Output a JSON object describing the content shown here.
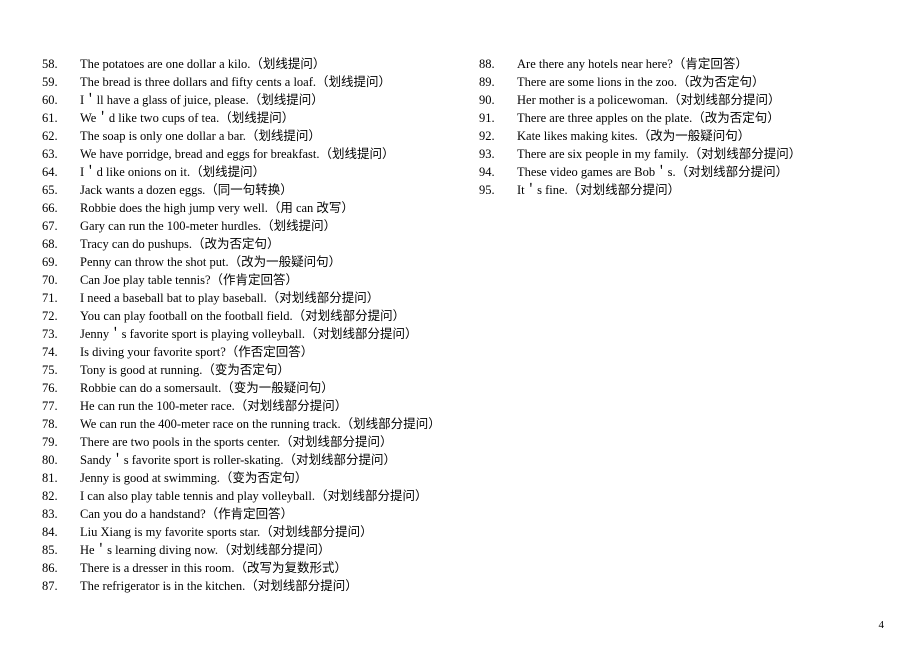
{
  "page_number": "4",
  "left_items": [
    {
      "n": "58.",
      "t": "The potatoes are one dollar a kilo.（划线提问）"
    },
    {
      "n": "59.",
      "t": "The bread is three dollars and fifty cents a loaf.（划线提问）"
    },
    {
      "n": "60.",
      "t": "I＇ll have a glass of juice, please.（划线提问）"
    },
    {
      "n": "61.",
      "t": "We＇d like two cups of tea.（划线提问）"
    },
    {
      "n": "62.",
      "t": "The soap is only one dollar a bar.（划线提问）"
    },
    {
      "n": "63.",
      "t": "We have porridge, bread and eggs for breakfast.（划线提问）"
    },
    {
      "n": "64.",
      "t": "I＇d like onions on it.（划线提问）"
    },
    {
      "n": "65.",
      "t": "Jack wants a dozen eggs.（同一句转换）"
    },
    {
      "n": "66.",
      "t": "Robbie does the high jump very well.（用 can  改写）"
    },
    {
      "n": "67.",
      "t": "Gary can run the 100-meter hurdles.（划线提问）"
    },
    {
      "n": "68.",
      "t": "Tracy can do pushups.（改为否定句）"
    },
    {
      "n": "69.",
      "t": "Penny can throw the shot put.（改为一般疑问句）"
    },
    {
      "n": "70.",
      "t": "Can Joe play table tennis?（作肯定回答）"
    },
    {
      "n": "71.",
      "t": "I need a baseball bat to play baseball.（对划线部分提问）"
    },
    {
      "n": "72.",
      "t": "You can play football on the football field.（对划线部分提问）"
    },
    {
      "n": "73.",
      "t": "Jenny＇s favorite sport is playing volleyball.（对划线部分提问）"
    },
    {
      "n": "74.",
      "t": "Is diving your favorite sport?（作否定回答）"
    },
    {
      "n": "75.",
      "t": "Tony is good at running.（变为否定句）"
    },
    {
      "n": "76.",
      "t": "Robbie can do a somersault.（变为一般疑问句）"
    },
    {
      "n": "77.",
      "t": "He can run the 100-meter race.（对划线部分提问）"
    },
    {
      "n": "78.",
      "t": "We can run the 400-meter race on the running track.（划线部分提问）"
    },
    {
      "n": "79.",
      "t": "There are two pools in the sports center.（对划线部分提问）"
    },
    {
      "n": "80.",
      "t": "Sandy＇s favorite sport is roller-skating.（对划线部分提问）"
    },
    {
      "n": "81.",
      "t": "Jenny is good at swimming.（变为否定句）"
    },
    {
      "n": "82.",
      "t": "I can also play table tennis and play volleyball.（对划线部分提问）"
    },
    {
      "n": "83.",
      "t": "Can you do a handstand?（作肯定回答）"
    },
    {
      "n": "84.",
      "t": "Liu Xiang is my favorite sports star.（对划线部分提问）"
    },
    {
      "n": "85.",
      "t": "He＇s learning diving now.（对划线部分提问）"
    },
    {
      "n": "86.",
      "t": "There is a dresser in this room.（改写为复数形式）"
    },
    {
      "n": "87.",
      "t": "The refrigerator is in the kitchen.（对划线部分提问）"
    }
  ],
  "right_items": [
    {
      "n": "88.",
      "t": "Are there any hotels near here?（肯定回答）"
    },
    {
      "n": "89.",
      "t": "There are some lions in the zoo.（改为否定句）"
    },
    {
      "n": "90.",
      "t": "Her mother is a policewoman.（对划线部分提问）"
    },
    {
      "n": "91.",
      "t": "There are three apples on the plate.（改为否定句）"
    },
    {
      "n": "92.",
      "t": "Kate likes making kites.（改为一般疑问句）"
    },
    {
      "n": "93.",
      "t": "There are six people in my family.（对划线部分提问）"
    },
    {
      "n": "94.",
      "t": "These video games are Bob＇s.（对划线部分提问）"
    },
    {
      "n": "95.",
      "t": "It＇s fine.（对划线部分提问）"
    }
  ]
}
